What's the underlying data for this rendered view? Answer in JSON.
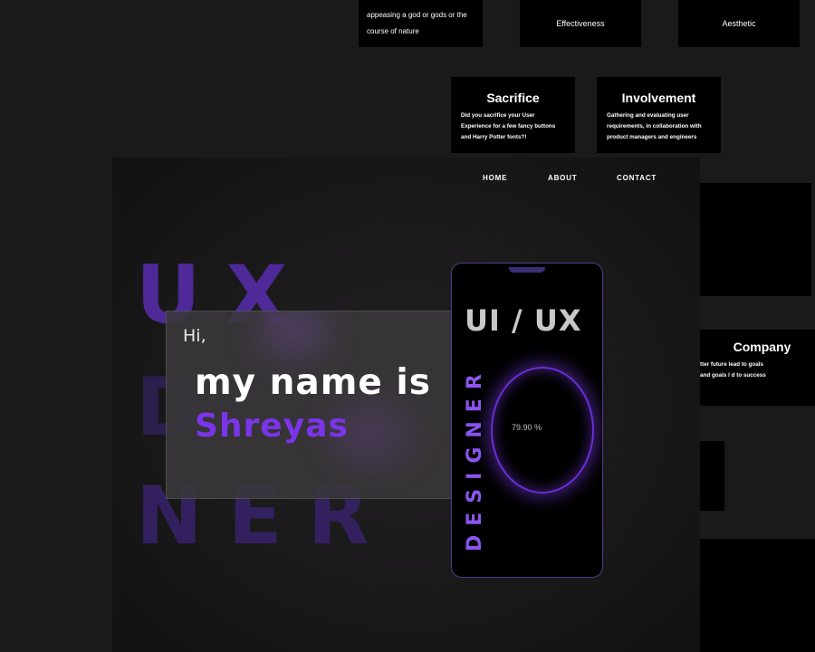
{
  "cards": {
    "nature_text": "appeasing a god or gods or the course of nature",
    "effectiveness": "Effectiveness",
    "aesthetic": "Aesthetic",
    "sacrifice": {
      "title": "Sacrifice",
      "body": "Did you sacrifice your User Experience for a few fancy buttons and Harry Potter fonts?!"
    },
    "involvement": {
      "title": "Involvement",
      "body": "Gathering and evaluating user requirements, in collaboration with product managers and engineers"
    },
    "company": {
      "title": "Company",
      "body": "tter future lead to goals and goals l d to success"
    }
  },
  "nav": {
    "home": "HOME",
    "about": "ABOUT",
    "contact": "CONTACT"
  },
  "hero": {
    "bg_row1": "UX",
    "bg_row2": "D",
    "bg_row3": "NER",
    "greeting": "Hi,",
    "line1": "my name is",
    "name": "Shreyas"
  },
  "phone": {
    "title": "UI / UX",
    "vertical": "DESIGNER",
    "progress": "79.90 %"
  },
  "colors": {
    "accent": "#7b34e8",
    "bg_letters": "#4a2a8a",
    "background": "#1b1a1b"
  }
}
